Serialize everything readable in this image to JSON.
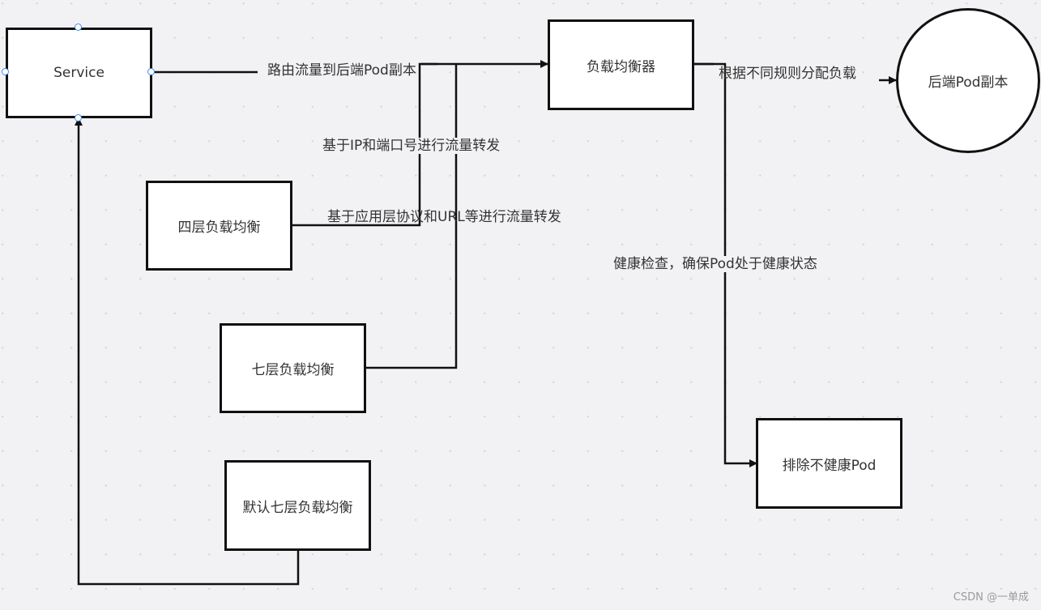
{
  "diagram": {
    "nodes": {
      "service": {
        "label": "Service"
      },
      "load_balancer": {
        "label": "负载均衡器"
      },
      "backend_pods": {
        "label": "后端Pod副本"
      },
      "l4_lb": {
        "label": "四层负载均衡"
      },
      "l7_lb": {
        "label": "七层负载均衡"
      },
      "default_l7_lb": {
        "label": "默认七层负载均衡"
      },
      "exclude_unhealthy": {
        "label": "排除不健康Pod"
      }
    },
    "edges": {
      "service_to_lb": {
        "label": "路由流量到后端Pod副本"
      },
      "l4_to_lb": {
        "label": "基于IP和端口号进行流量转发"
      },
      "l7_to_lb": {
        "label": "基于应用层协议和URL等进行流量转发"
      },
      "lb_to_pods": {
        "label": "根据不同规则分配负载"
      },
      "lb_to_exclude": {
        "label": "健康检查，确保Pod处于健康状态"
      },
      "default_to_service": {
        "label": ""
      }
    },
    "selection": {
      "selected_node": "service"
    },
    "colors": {
      "background": "#f2f2f4",
      "stroke": "#111111",
      "text": "#333333",
      "handle": "#3d8ef0"
    }
  },
  "watermark": "CSDN @一单成"
}
